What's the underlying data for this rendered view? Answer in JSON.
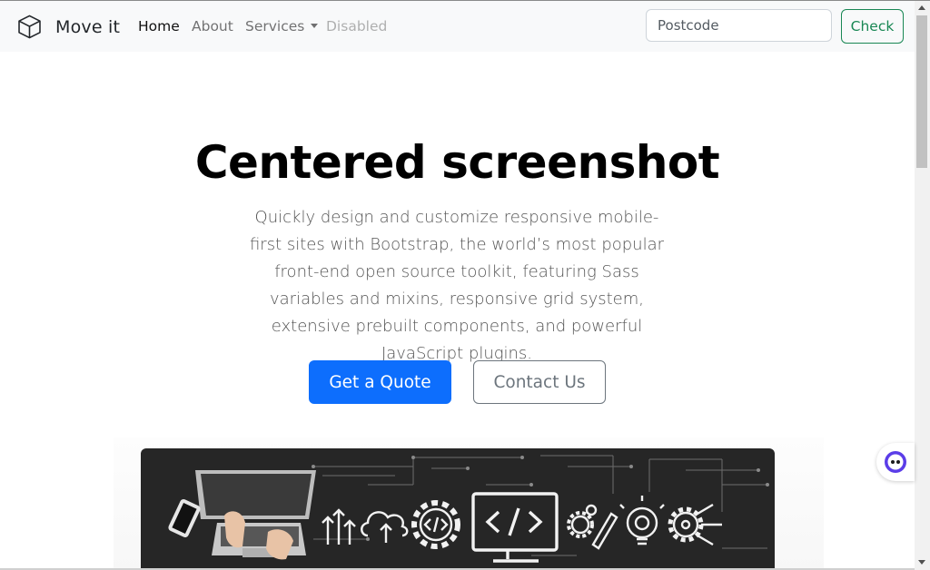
{
  "navbar": {
    "brand": "Move it",
    "brand_icon": "box-icon",
    "links": {
      "home": "Home",
      "about": "About",
      "services": "Services",
      "disabled": "Disabled"
    },
    "search": {
      "placeholder": "Postcode",
      "value": ""
    },
    "check_label": "Check"
  },
  "hero": {
    "title": "Centered screenshot",
    "lead": "Quickly design and customize responsive mobile-first sites with Bootstrap, the world’s most popular front-end open source toolkit, featuring Sass variables and mixins, responsive grid system, extensive prebuilt components, and powerful JavaScript plugins.",
    "primary_button": "Get a Quote",
    "secondary_button": "Contact Us",
    "image_icons": [
      "laptop-icon",
      "phone-icon",
      "arrows-up-icon",
      "cloud-upload-icon",
      "code-gear-icon",
      "code-monitor-icon",
      "gears-pencil-icon",
      "bulb-gear-icon",
      "gear-icon"
    ]
  },
  "colors": {
    "primary": "#0d6efd",
    "success": "#198754",
    "secondary": "#6c757d",
    "navbar_bg": "#f8f9fa",
    "image_bg": "#262626"
  }
}
